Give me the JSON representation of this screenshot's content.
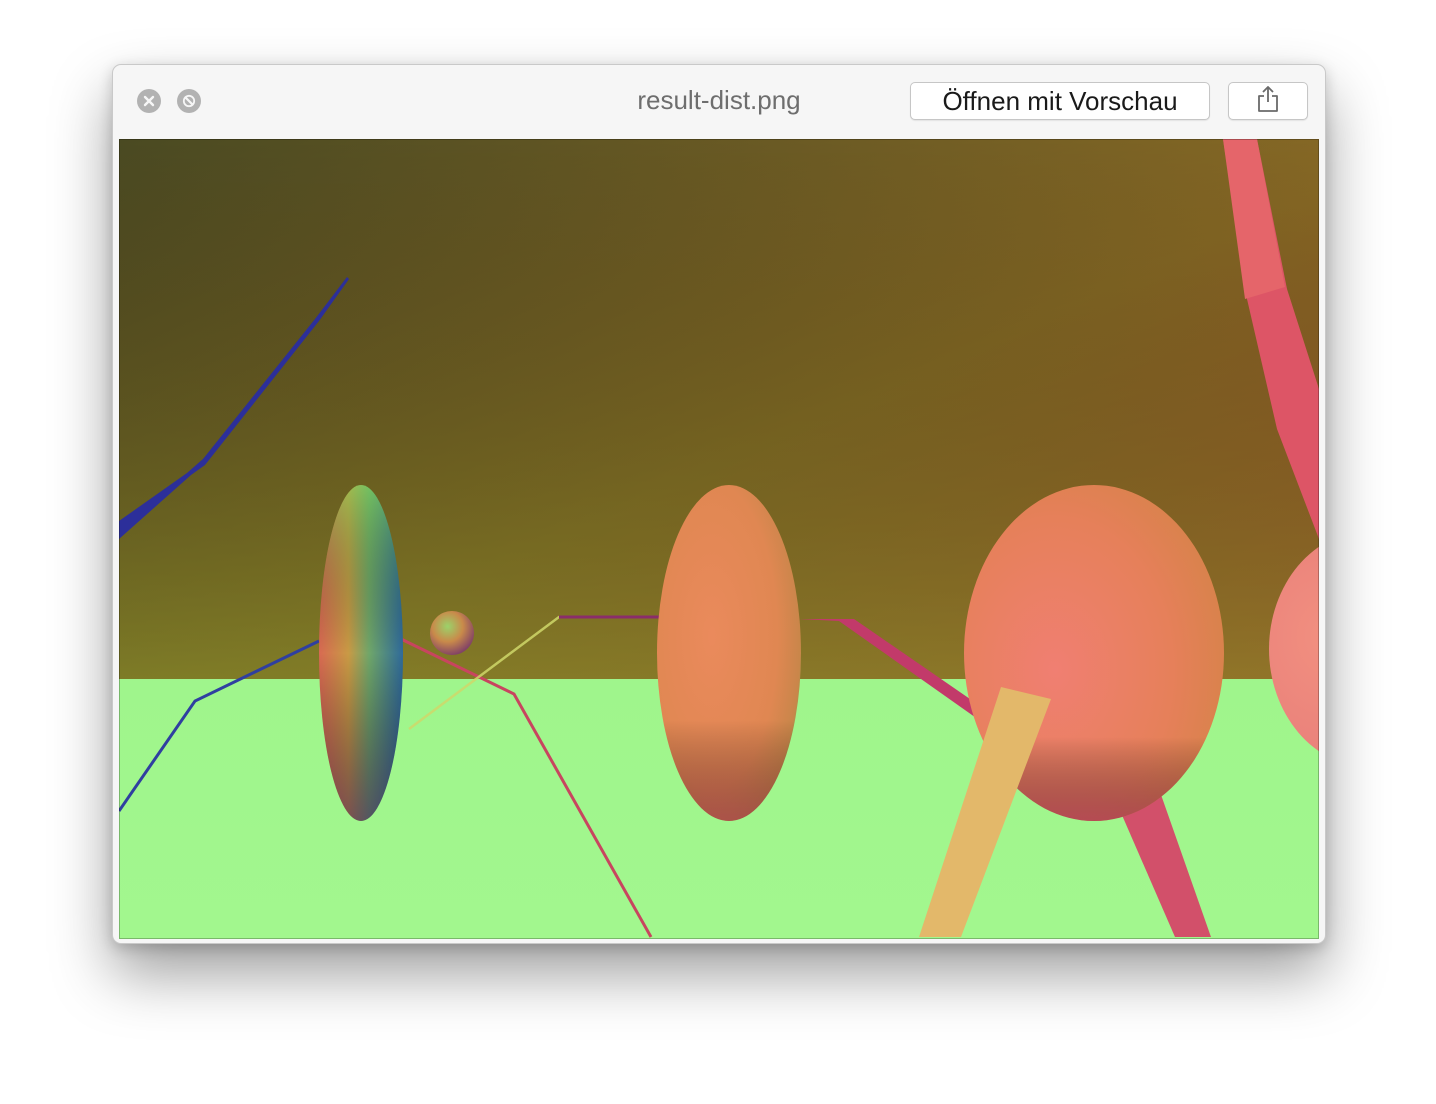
{
  "window": {
    "title": "result-dist.png"
  },
  "toolbar": {
    "open_with_label": "Öffnen mit Vorschau",
    "close_icon": "close-icon",
    "fullscreen_icon": "fullscreen-icon",
    "share_icon": "share-icon"
  },
  "preview": {
    "image_name": "result-dist.png",
    "colors": {
      "sky_top_left": "#4a4a22",
      "sky_top_right": "#b0582a",
      "sky_horizon": "#8a8226",
      "floor": "#9ef58a",
      "accent_blue": "#2c2f9a",
      "accent_pink": "#dd5566",
      "accent_gold": "#e3b86a"
    }
  }
}
